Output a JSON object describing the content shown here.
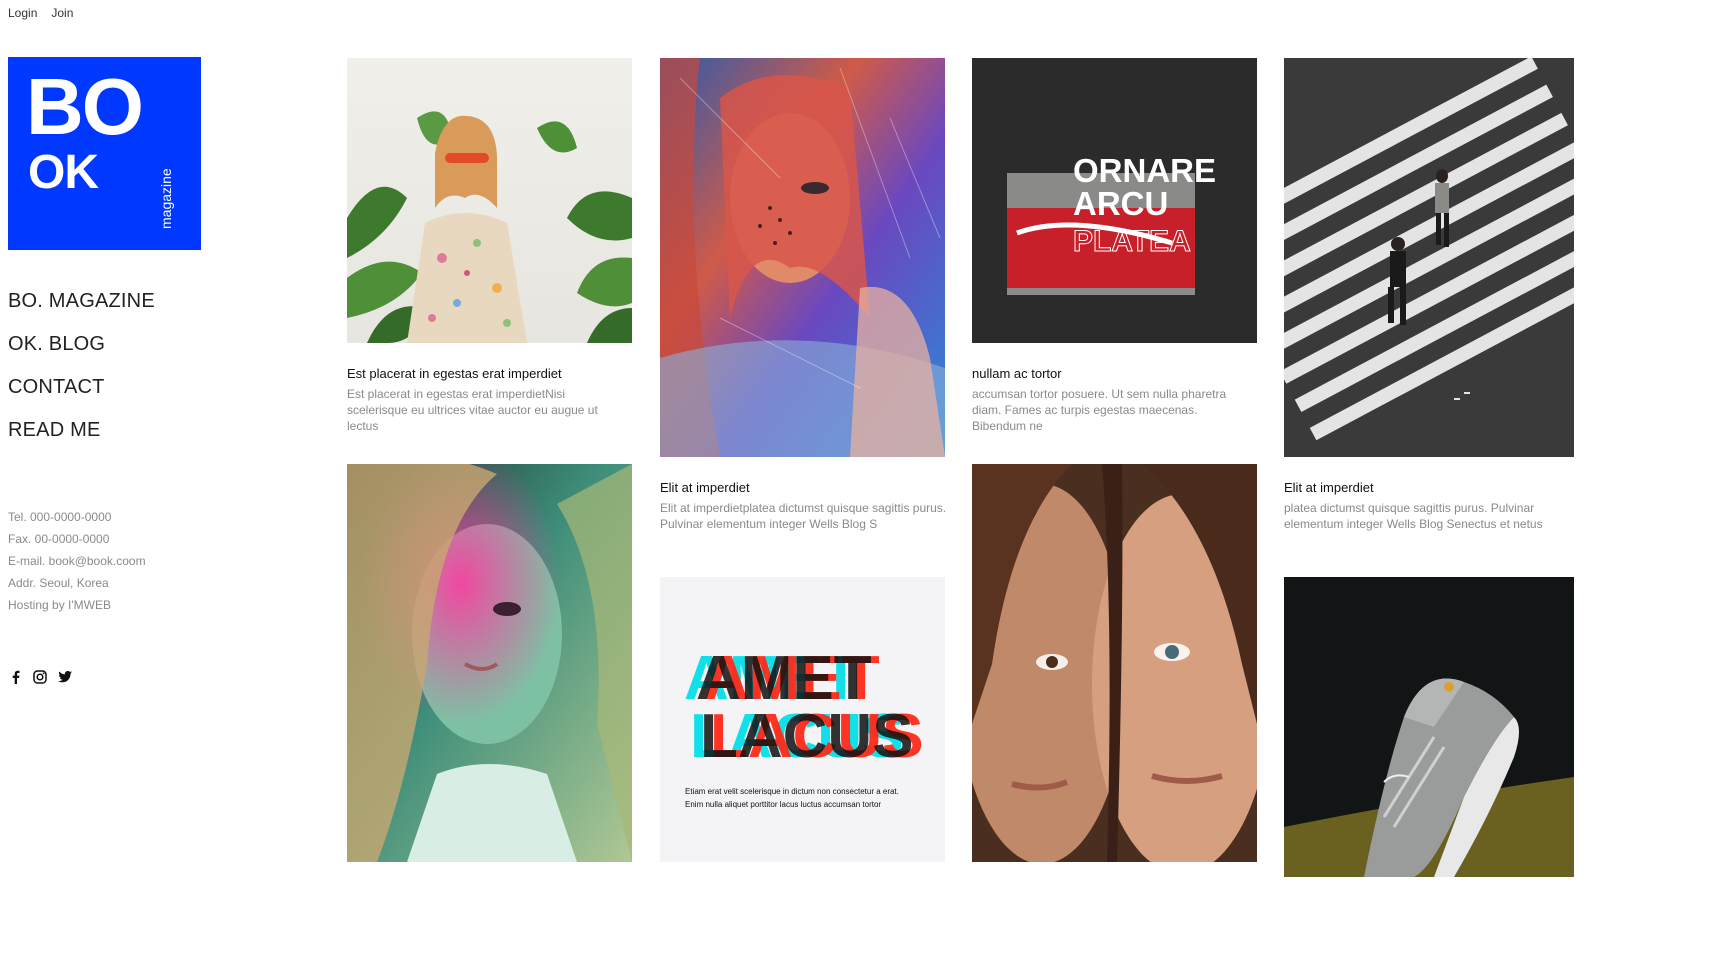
{
  "topbar": {
    "login": "Login",
    "join": "Join"
  },
  "logo": {
    "line1": "BO",
    "line2": "OK",
    "tag": "magazine",
    "color": "#0038ff"
  },
  "nav": [
    "BO. MAGAZINE",
    "OK. BLOG",
    "CONTACT",
    "READ ME"
  ],
  "info": {
    "tel": "Tel. 000-0000-0000",
    "fax": "Fax. 00-0000-0000",
    "email": "E-mail. book@book.coom",
    "addr": "Addr. Seoul, Korea",
    "hosting": "Hosting by I'MWEB"
  },
  "social": [
    "facebook-icon",
    "instagram-icon",
    "twitter-icon"
  ],
  "cards": [
    {
      "title": "Est placerat in egestas erat imperdiet",
      "desc": "Est placerat in egestas erat imperdietNisi scelerisque eu ultrices vitae auctor eu augue ut lectus"
    },
    {
      "title": "Elit at imperdiet",
      "desc": "Elit at imperdietplatea dictumst quisque sagittis purus. Pulvinar elementum integer Wells Blog S"
    },
    {
      "title": "nullam ac tortor",
      "desc": "accumsan tortor posuere. Ut sem nulla pharetra diam. Fames ac turpis egestas maecenas. Bibendum ne"
    },
    {
      "title": "Elit at imperdiet",
      "desc": "platea dictumst quisque sagittis purus. Pulvinar elementum integer Wells Blog Senectus et netus"
    }
  ],
  "poster3": {
    "line1": "ORNARE",
    "line2": "ARCU",
    "line3": "PLATEA"
  },
  "poster6": {
    "line1": "AMET",
    "line2": "LACUS",
    "caption1": "Etiam erat velit scelerisque in dictum non consectetur a erat.",
    "caption2": "Enim nulla aliquet porttitor lacus luctus accumsan tortor"
  }
}
